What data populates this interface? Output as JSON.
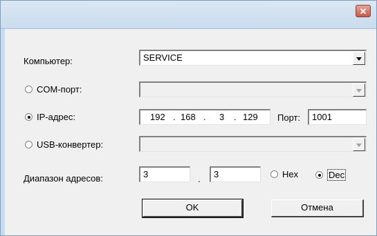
{
  "window": {
    "close_glyph": "✕"
  },
  "computer": {
    "label": "Компьютер:",
    "value": "SERVICE"
  },
  "com_port": {
    "label": "COM-порт:",
    "value": "",
    "selected": false
  },
  "ip": {
    "label": "IP-адрес:",
    "selected": true,
    "octet1": "192",
    "octet2": "168",
    "octet3": "3",
    "octet4": "129",
    "port_label": "Порт:",
    "port_value": "1001"
  },
  "usb": {
    "label": "USB-конвертер:",
    "value": "",
    "selected": false
  },
  "range": {
    "label": "Диапазон адресов:",
    "from": "3",
    "separator": ".",
    "to": "3",
    "hex_label": "Hex",
    "dec_label": "Dec",
    "mode": "Dec"
  },
  "buttons": {
    "ok": "OK",
    "cancel": "Отмена"
  }
}
